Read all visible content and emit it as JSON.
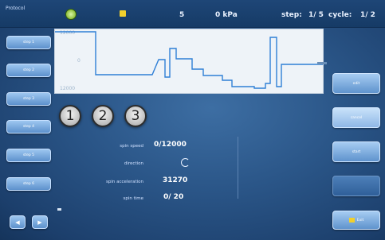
{
  "topbar": {
    "title": "Protocol",
    "lock_icon": "lock-icon",
    "speed_value": "5",
    "pressure": "0 kPa",
    "step_label": "step:",
    "step_value": "1/ 5",
    "cycle_label": "cycle:",
    "cycle_value": "1/ 2"
  },
  "sidebar": {
    "items": [
      {
        "label": "step 1"
      },
      {
        "label": "step 2"
      },
      {
        "label": "step 3"
      },
      {
        "label": "step 4"
      },
      {
        "label": "step 5"
      },
      {
        "label": "step 6"
      }
    ],
    "nav_left_icon": "arrow-left-icon",
    "nav_right_icon": "arrow-right-icon"
  },
  "graph": {
    "top_label": "12000",
    "mid_label": "0",
    "bottom_label": "12000"
  },
  "steps": [
    "1",
    "2",
    "3"
  ],
  "params": [
    {
      "label": "spin speed",
      "value": "0/12000"
    },
    {
      "label": "direction",
      "value": ""
    },
    {
      "label": "spin acceleration",
      "value": "31270"
    },
    {
      "label": "spin time",
      "value": "0/  20"
    }
  ],
  "right_panel": {
    "buttons": [
      {
        "label": "edit"
      },
      {
        "label": "cancel"
      },
      {
        "label": "start"
      },
      {
        "label": ""
      }
    ],
    "exit_label": "Exit"
  },
  "colors": {
    "background": "#2a5587",
    "graph_line": "#2f7fd6",
    "accent": "#f2d02c"
  }
}
